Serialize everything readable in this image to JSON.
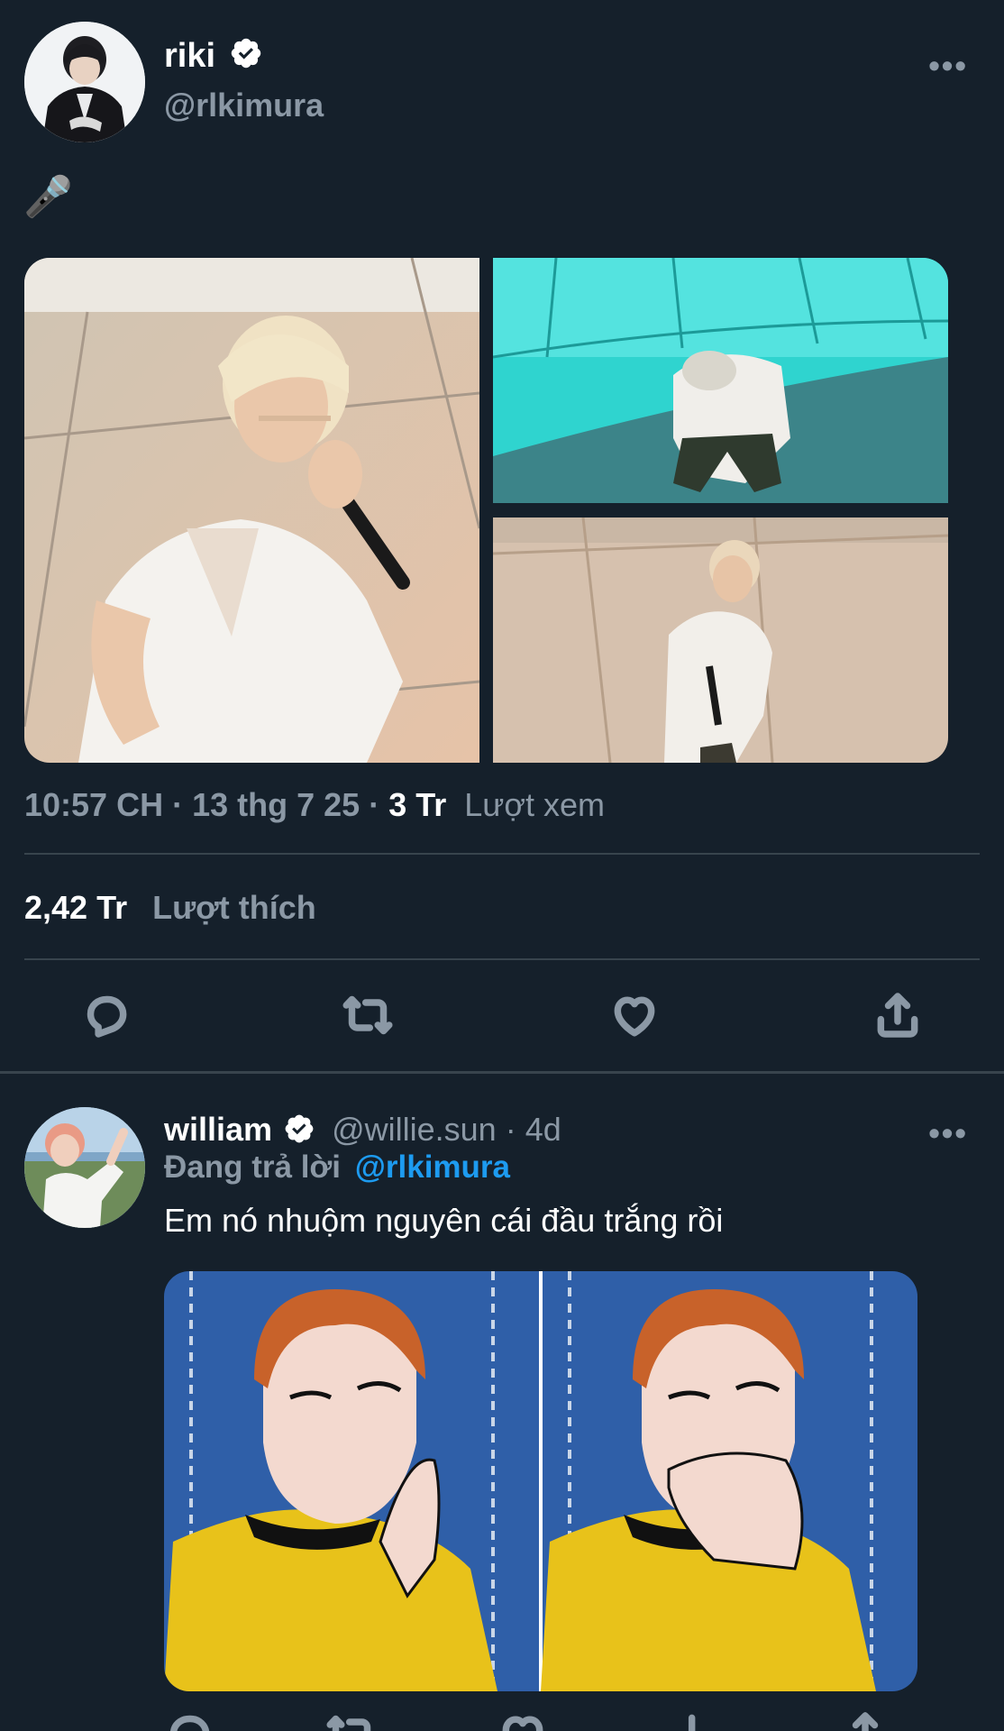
{
  "tweet": {
    "display_name": "riki",
    "handle": "@rlkimura",
    "text": "🎤",
    "time": "10:57 CH",
    "date": "13 thg 7 25",
    "views_count": "3 Tr",
    "views_label": "Lượt xem",
    "likes_count": "2,42 Tr",
    "likes_label": "Lượt thích",
    "more_label": "•••"
  },
  "reply": {
    "display_name": "william",
    "handle": "@willie.sun",
    "age": "4d",
    "replying_prefix": "Đang trả lời",
    "replying_to": "@rlkimura",
    "text": "Em nó nhuộm nguyên cái đầu trắng rồi",
    "more_label": "•••"
  },
  "colors": {
    "background": "#15202b",
    "secondary_text": "#8b98a5",
    "link": "#1d9bf0",
    "divider": "#38444d"
  },
  "icons": [
    "verified-badge-icon",
    "more-icon",
    "reply-icon",
    "retweet-icon",
    "like-icon",
    "share-icon",
    "microphone-emoji"
  ]
}
